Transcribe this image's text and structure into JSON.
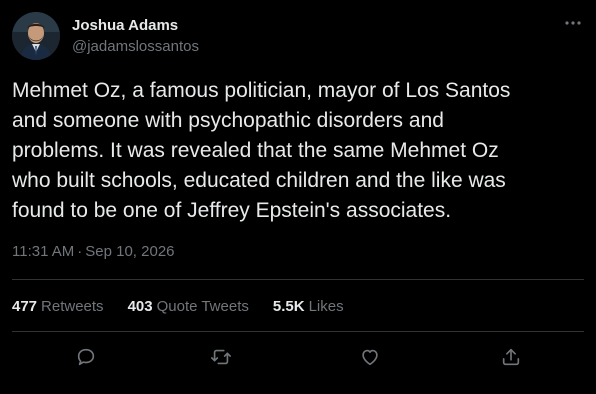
{
  "author": {
    "name": "Joshua Adams",
    "handle": "@jadamslossantos",
    "avatar_icon": "profile-photo"
  },
  "tweet": {
    "text": "Mehmet Oz, a famous politician, mayor of Los Santos\nand someone with psychopathic disorders and\nproblems. It was revealed that the same Mehmet Oz\nwho built schools, educated children and the like was\nfound to be one of Jeffrey Epstein's associates.",
    "time": "11:31 AM",
    "separator": "·",
    "date": "Sep 10, 2026"
  },
  "stats": {
    "retweets_count": "477",
    "retweets_label": "Retweets",
    "quotes_count": "403",
    "quotes_label": "Quote Tweets",
    "likes_count": "5.5K",
    "likes_label": "Likes"
  },
  "actions": {
    "reply_icon": "reply-icon",
    "retweet_icon": "retweet-icon",
    "like_icon": "heart-icon",
    "share_icon": "share-icon",
    "more_icon": "more-icon"
  },
  "colors": {
    "background": "#000000",
    "text_primary": "#e7e9ea",
    "text_secondary": "#71767b",
    "divider": "#2f3336"
  }
}
